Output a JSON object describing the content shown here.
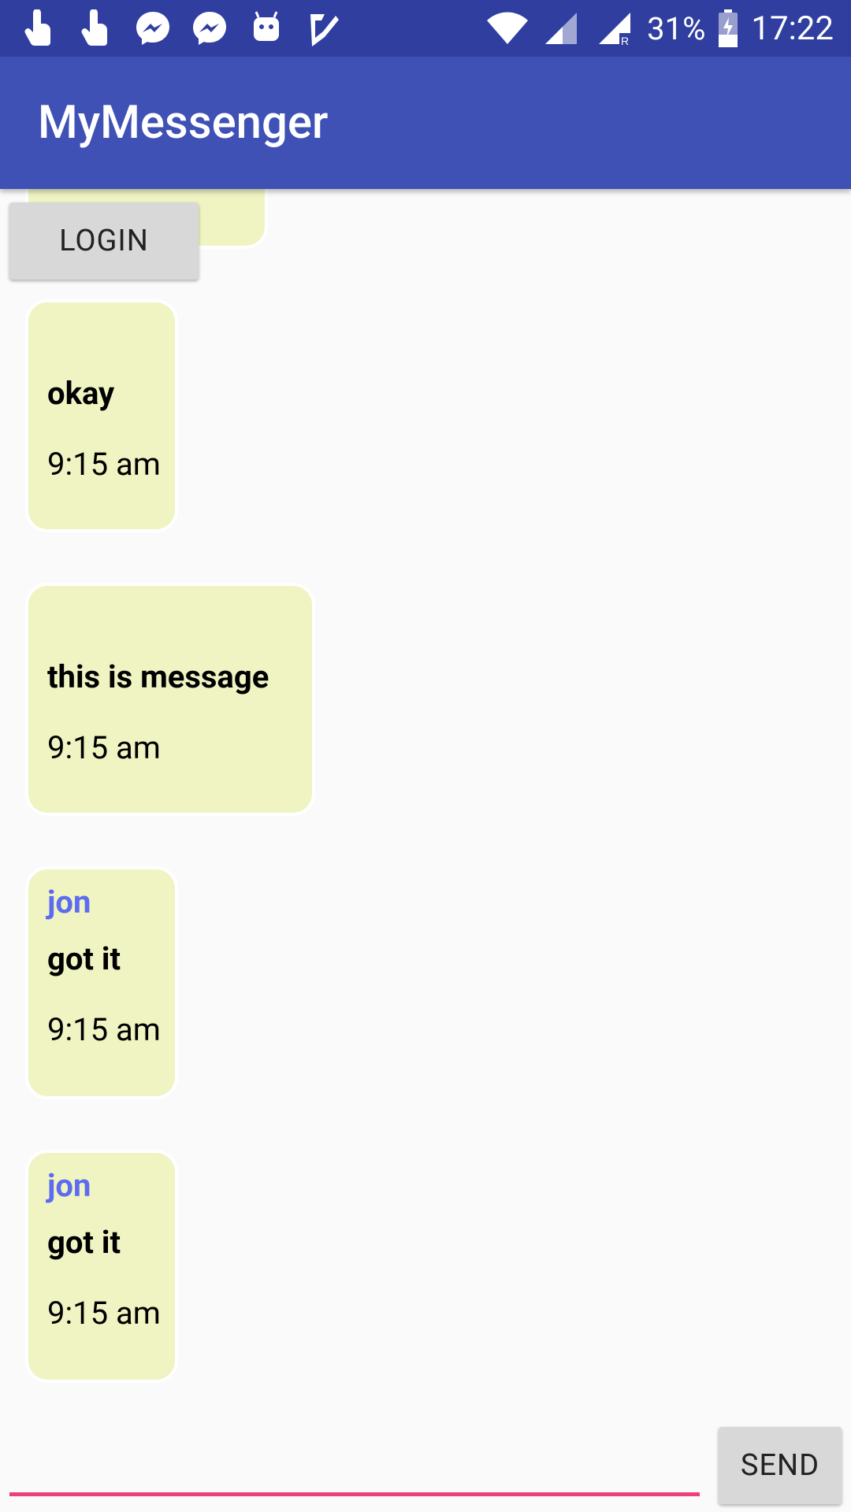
{
  "status_bar": {
    "battery": "31%",
    "time": "17:22",
    "left_icons": [
      "hand-pointer-icon",
      "hand-pointer-icon",
      "messenger-icon",
      "messenger-icon",
      "android-icon",
      "check-icon"
    ],
    "right_icons": [
      "wifi-icon",
      "signal-icon",
      "signal-roaming-icon",
      "battery-icon"
    ]
  },
  "app_bar": {
    "title": "MyMessenger"
  },
  "buttons": {
    "login": "LOGIN",
    "send": "SEND"
  },
  "input": {
    "value": "",
    "placeholder": ""
  },
  "messages": [
    {
      "sender": "",
      "text": "okay",
      "time": "9:15 am"
    },
    {
      "sender": "",
      "text": "this is message",
      "time": "9:15 am"
    },
    {
      "sender": "jon",
      "text": "got it",
      "time": "9:15 am"
    },
    {
      "sender": "jon",
      "text": "got it",
      "time": "9:15 am"
    }
  ],
  "colors": {
    "status_bar": "#303f9f",
    "app_bar": "#3f51b5",
    "bubble": "#f0f4c3",
    "sender": "#5c6bf0",
    "input_underline": "#ec407a"
  }
}
